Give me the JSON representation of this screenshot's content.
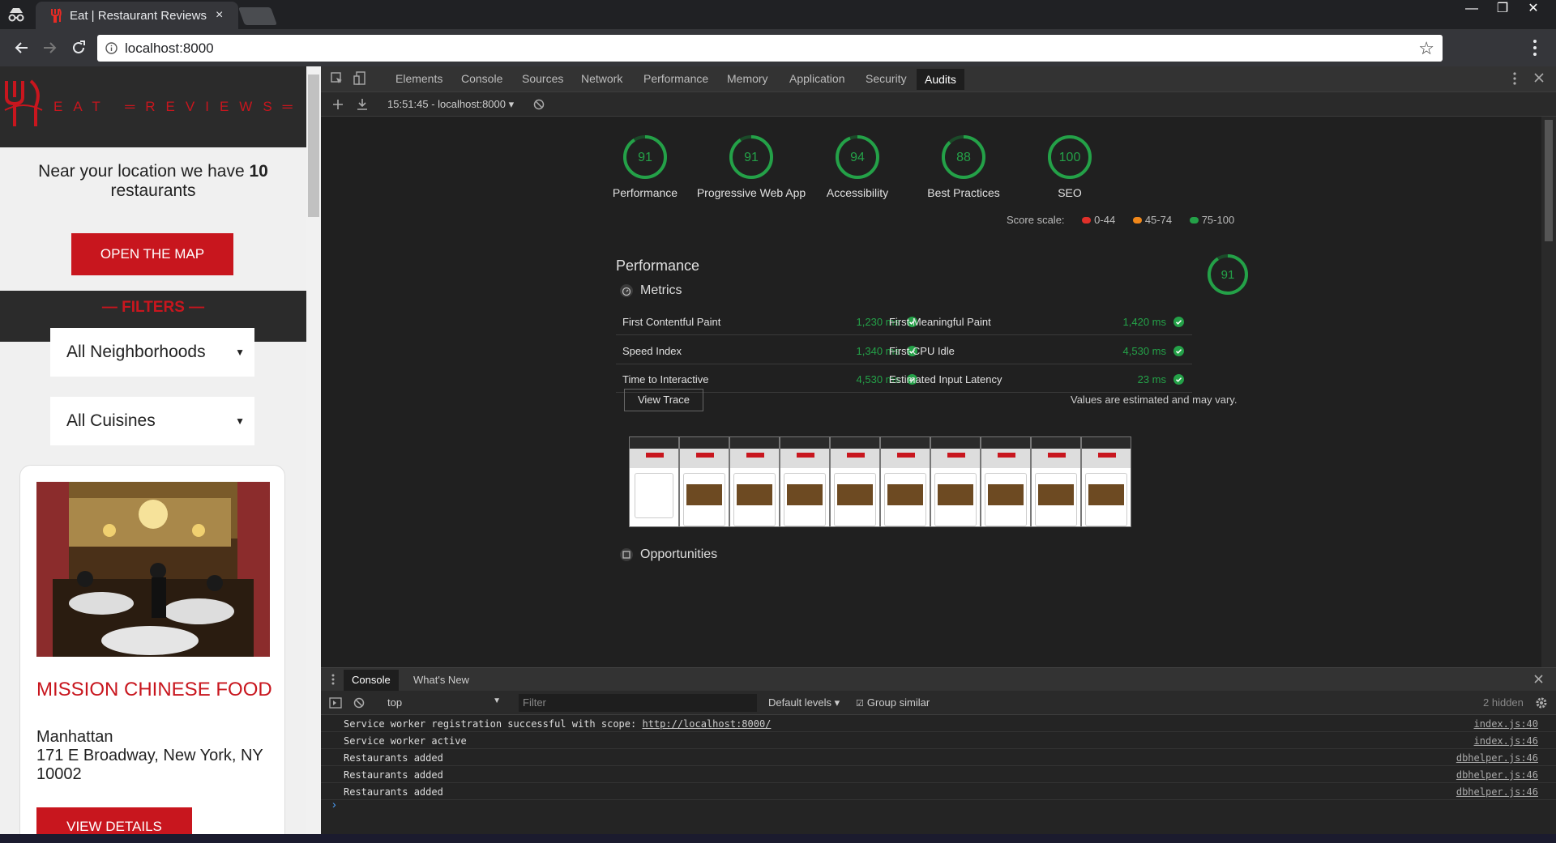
{
  "browser": {
    "tab_title": "Eat | Restaurant Reviews",
    "tab_close": "×",
    "url": "localhost:8000",
    "window_min": "—",
    "window_restore": "❐",
    "window_close": "✕"
  },
  "site": {
    "logo_text": "EAT  ═REVIEWS═",
    "near_prefix": "Near your location we have ",
    "near_count": "10",
    "near_suffix": " restaurants",
    "open_map": "OPEN THE MAP",
    "filters_title": "— FILTERS —",
    "neighborhoods": "All Neighborhoods",
    "cuisines": "All Cuisines",
    "select_arrow": "▼",
    "restaurant": {
      "name": "MISSION CHINESE FOOD",
      "neighborhood": "Manhattan",
      "address": "171 E Broadway, New York, NY 10002",
      "details_button": "VIEW DETAILS"
    }
  },
  "devtools": {
    "tabs": [
      "Elements",
      "Console",
      "Sources",
      "Network",
      "Performance",
      "Memory",
      "Application",
      "Security",
      "Audits"
    ],
    "active_tab": "Audits",
    "report_selector": "15:51:45 - localhost:8000 ▾",
    "scores": [
      {
        "label": "Performance",
        "value": "91"
      },
      {
        "label": "Progressive Web App",
        "value": "91"
      },
      {
        "label": "Accessibility",
        "value": "94"
      },
      {
        "label": "Best Practices",
        "value": "88"
      },
      {
        "label": "SEO",
        "value": "100"
      }
    ],
    "score_scale": {
      "label": "Score scale:",
      "ranges": [
        {
          "label": "0-44",
          "color": "#e0302a"
        },
        {
          "label": "45-74",
          "color": "#f0871a"
        },
        {
          "label": "75-100",
          "color": "#24a148"
        }
      ]
    },
    "section_title": "Performance",
    "section_score": "91",
    "metrics_header": "Metrics",
    "metrics": [
      {
        "name": "First Contentful Paint",
        "value": "1,230 ms"
      },
      {
        "name": "First Meaningful Paint",
        "value": "1,420 ms"
      },
      {
        "name": "Speed Index",
        "value": "1,340 ms"
      },
      {
        "name": "First CPU Idle",
        "value": "4,530 ms"
      },
      {
        "name": "Time to Interactive",
        "value": "4,530 ms"
      },
      {
        "name": "Estimated Input Latency",
        "value": "23 ms"
      }
    ],
    "view_trace": "View Trace",
    "estimated_note": "Values are estimated and may vary.",
    "opportunities": "Opportunities",
    "pass_color": "#24a148"
  },
  "console": {
    "tabs": [
      "Console",
      "What's New"
    ],
    "context": "top",
    "filter_placeholder": "Filter",
    "levels": "Default levels ▾",
    "group_similar": "Group similar",
    "hidden_count": "2 hidden",
    "logs": [
      {
        "msg": "Service worker registration successful with scope: ",
        "link": "http://localhost:8000/",
        "src": "index.js:40"
      },
      {
        "msg": "Service worker active",
        "link": "",
        "src": "index.js:46"
      },
      {
        "msg": "Restaurants added",
        "link": "",
        "src": "dbhelper.js:46"
      },
      {
        "msg": "Restaurants added",
        "link": "",
        "src": "dbhelper.js:46"
      },
      {
        "msg": "Restaurants added",
        "link": "",
        "src": "dbhelper.js:46"
      }
    ],
    "prompt": "›"
  }
}
